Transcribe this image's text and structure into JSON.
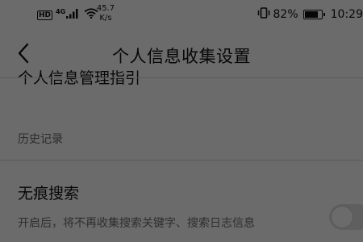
{
  "status_bar": {
    "hd": "HD",
    "network": "4G",
    "speed_value": "45.7",
    "speed_unit": "K/s",
    "battery_percent": "82%",
    "time": "10:29"
  },
  "header": {
    "title": "个人信息收集设置"
  },
  "content": {
    "previous_item": "个人信息管理指引",
    "section_header": "历史记录",
    "setting": {
      "title": "无痕搜索",
      "description": "开启后，将不再收集搜索关键字、搜索日志信息",
      "enabled": false
    }
  },
  "icons": {
    "back": "chevron-left-icon",
    "signal": "cellular-signal-icon",
    "wifi": "wifi-icon",
    "vibrate": "vibrate-icon",
    "battery": "battery-icon"
  }
}
